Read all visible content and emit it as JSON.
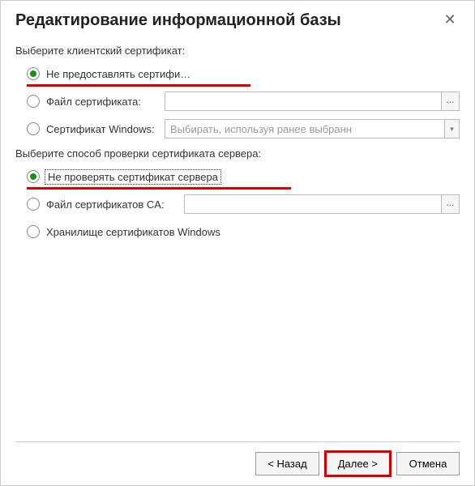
{
  "dialog": {
    "title": "Редактирование информационной базы",
    "close": "✕"
  },
  "clientCert": {
    "label": "Выберите клиентский сертификат:",
    "opt1": "Не предоставлять сертифи…",
    "opt2": "Файл сертификата:",
    "opt3": "Сертификат Windows:",
    "fileValue": "",
    "windowsValue": "Выбирать, используя ранее выбранн"
  },
  "serverCert": {
    "label": "Выберите способ проверки сертификата сервера:",
    "opt1": "Не проверять сертификат сервера",
    "opt2": "Файл сертификатов CA:",
    "opt3": "Хранилище сертификатов Windows",
    "caFileValue": ""
  },
  "buttons": {
    "back": "< Назад",
    "next": "Далее >",
    "cancel": "Отмена"
  },
  "ellipsis": "..."
}
